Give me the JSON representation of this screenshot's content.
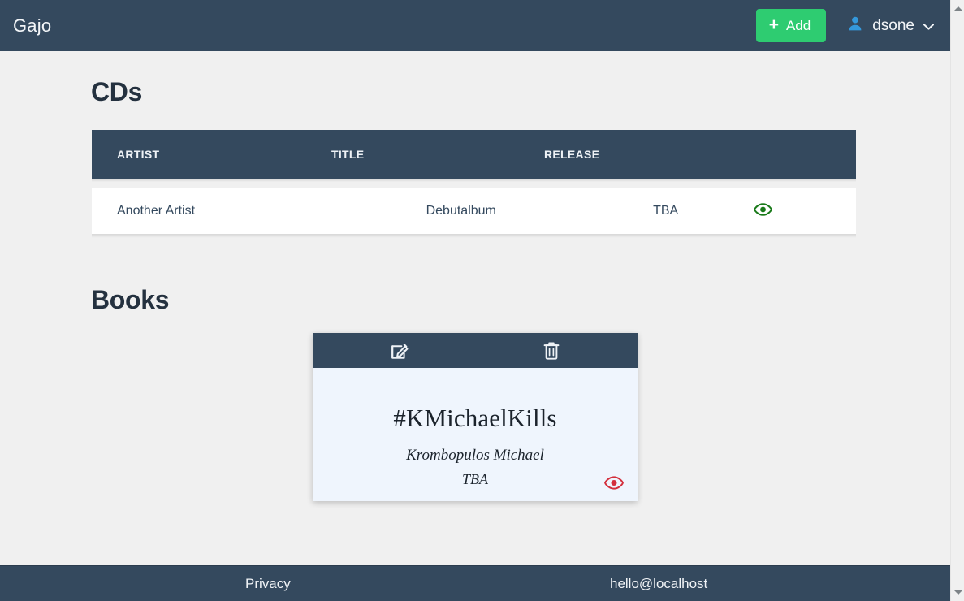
{
  "navbar": {
    "brand": "Gajo",
    "add_label": "Add",
    "add_plus": "+",
    "add_color": "#2ecc71",
    "user_name": "dsone",
    "user_caret": "⌄",
    "nav_color": "#34495e",
    "avatar_color": "#3498db"
  },
  "sections": {
    "cds": {
      "title": "CDs",
      "table": {
        "columns": [
          "ARTIST",
          "TITLE",
          "RELEASE",
          ""
        ],
        "rows": [
          {
            "artist": "Another Artist",
            "title": "Debutalbum",
            "release": "TBA",
            "view_icon": "eye-icon",
            "view_color": "#1a7a1a"
          }
        ]
      }
    },
    "books": {
      "title": "Books",
      "cards": [
        {
          "title": "#KMichaelKills",
          "author": "Krombopulos Michael",
          "release": "TBA",
          "edit_icon": "edit-icon",
          "delete_icon": "trash-icon",
          "view_icon": "eye-icon",
          "view_color": "#d32f3c",
          "header_color": "#34495e",
          "body_color": "#eff5fd"
        }
      ]
    }
  },
  "footer": {
    "privacy": "Privacy",
    "email": "hello@localhost"
  },
  "page": {
    "background": "#f0f0f0",
    "text_color": "#34495e"
  }
}
